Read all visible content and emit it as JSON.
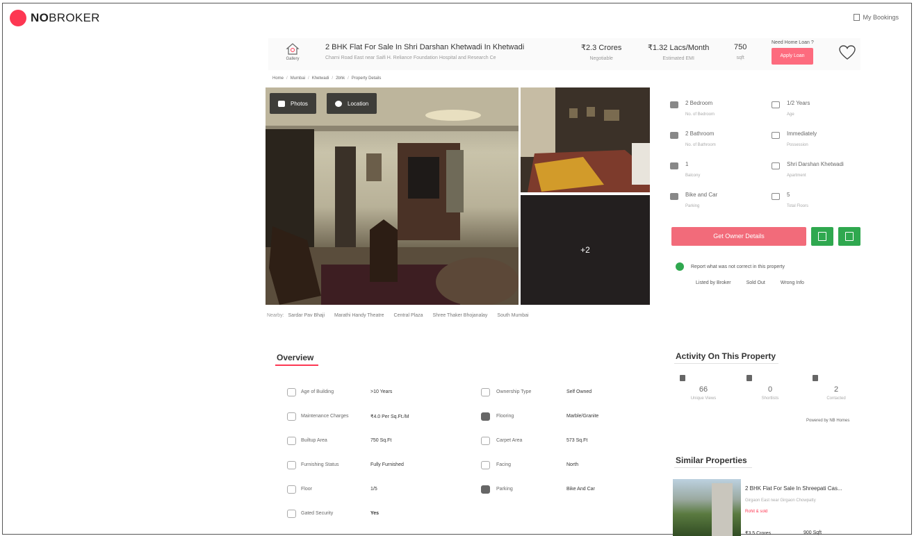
{
  "brand": {
    "name_bold": "NO",
    "name_light": "BROKER",
    "accent": "#fd3752"
  },
  "topbar": {
    "bookings_label": "My Bookings"
  },
  "header": {
    "gallery_caption": "Gallery",
    "title": "2 BHK Flat For Sale In Shri Darshan Khetwadi In Khetwadi",
    "address": "Charni Road East near Saifi H. Reliance Foundation Hospital and Research Ce",
    "price": "₹2.3 Crores",
    "price_note": "Negotiable",
    "emi": "₹1.32 Lacs/Month",
    "emi_note": "Estimated EMI",
    "area": "750",
    "area_unit": "sqft",
    "loan_question": "Need Home Loan ?",
    "loan_button": "Apply Loan"
  },
  "breadcrumb": [
    "Home",
    "Mumbai",
    "Khetwadi",
    "2bhk",
    "Property Details"
  ],
  "gallery": {
    "photos_button": "Photos",
    "location_button": "Location",
    "more_count": "+2"
  },
  "nearby": {
    "label": "Nearby:",
    "places": [
      "Sardar Pav Bhaji",
      "Marathi Handy Theatre",
      "Central Plaza",
      "Shree Thaker Bhojanalay",
      "South Mumbai"
    ]
  },
  "details": [
    {
      "value": "2 Bedroom",
      "label": "No. of Bedroom"
    },
    {
      "value": "1/2 Years",
      "label": "Age"
    },
    {
      "value": "2 Bathroom",
      "label": "No. of Bathroom"
    },
    {
      "value": "Immediately",
      "label": "Possession"
    },
    {
      "value": "1",
      "label": "Balcony"
    },
    {
      "value": "Shri Darshan Khetwadi",
      "label": "Apartment"
    },
    {
      "value": "Bike and Car",
      "label": "Parking"
    },
    {
      "value": "5",
      "label": "Total Floors"
    }
  ],
  "actions": {
    "owner_button": "Get Owner Details",
    "green": "#2fa84f"
  },
  "report": {
    "text": "Report what was not correct in this property",
    "options": [
      "Listed by Broker",
      "Sold Out",
      "Wrong Info"
    ]
  },
  "overview": {
    "title": "Overview",
    "left": [
      {
        "label": "Age of Building",
        "value": ">10 Years"
      },
      {
        "label": "Maintenance Charges",
        "value": "₹4.0 Per Sq.Ft./M"
      },
      {
        "label": "Builtup Area",
        "value": "750 Sq.Ft"
      },
      {
        "label": "Furnishing Status",
        "value": "Fully Furnished"
      },
      {
        "label": "Floor",
        "value": "1/5"
      },
      {
        "label": "Gated Security",
        "value": "Yes"
      }
    ],
    "right": [
      {
        "label": "Ownership Type",
        "value": "Self Owned"
      },
      {
        "label": "Flooring",
        "value": "Marble/Granite"
      },
      {
        "label": "Carpet Area",
        "value": "573 Sq.Ft"
      },
      {
        "label": "Facing",
        "value": "North"
      },
      {
        "label": "Parking",
        "value": "Bike And Car"
      }
    ]
  },
  "activity": {
    "title": "Activity On This Property",
    "items": [
      {
        "value": "66",
        "label": "Unique Views"
      },
      {
        "value": "0",
        "label": "Shortlists"
      },
      {
        "value": "2",
        "label": "Contacted"
      }
    ],
    "powered": "Powered by NB Homes"
  },
  "similar": {
    "title": "Similar Properties",
    "card_title": "2 BHK Flat For Sale In Shreepati Cas...",
    "card_sub": "Girgaon East near Girgaon Chowpatty",
    "card_red": "Rohit & sold",
    "card_price": "₹3.5 Crores",
    "card_area": "900 Sqft"
  }
}
